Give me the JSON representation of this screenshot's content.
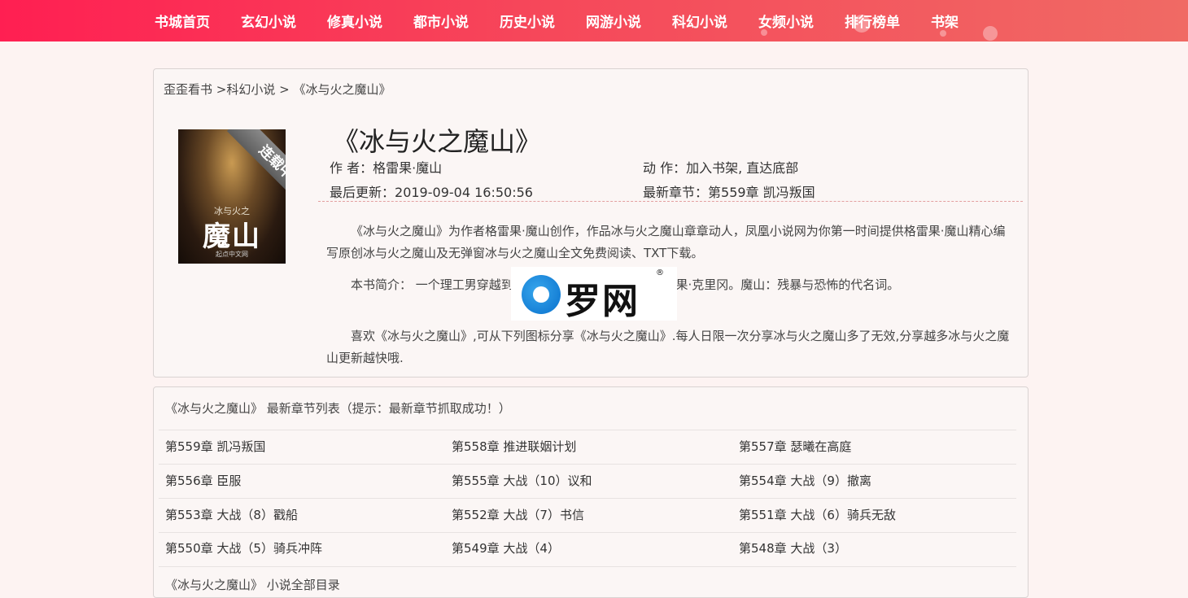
{
  "nav": [
    "书城首页",
    "玄幻小说",
    "修真小说",
    "都市小说",
    "历史小说",
    "网游小说",
    "科幻小说",
    "女频小说",
    "排行榜单",
    "书架"
  ],
  "breadcrumb": {
    "home": "歪歪看书",
    "sep1": " >",
    "category": "科幻小说",
    "sep2": " > ",
    "book": "《冰与火之魔山》"
  },
  "cover": {
    "ribbon": "连载中",
    "subtitle": "冰与火之",
    "title": "魔山",
    "publisher": "起点中文网"
  },
  "book": {
    "title": "《冰与火之魔山》",
    "author_label": "作  者：",
    "author": "格雷果·魔山",
    "action_label": "动  作：",
    "action_add": "加入书架",
    "action_sep": ", ",
    "action_bottom": "直达底部",
    "updated_label": "最后更新：",
    "updated": "2019-09-04 16:50:56",
    "latest_label": "最新章节：",
    "latest": "第559章 凯冯叛国"
  },
  "paragraphs": [
    "《冰与火之魔山》为作者格雷果·魔山创作，作品冰与火之魔山章章动人，凤凰小说网为你第一时间提供格雷果·魔山精心编写原创冰与火之魔山及无弹窗冰与火之魔山全文免费阅读、TXT下载。",
    "本书简介：  一个理工男穿越到                      最恶的凶人：人称魔山的格雷果·克里冈。魔山：残暴与恐怖的代名词。",
    "喜欢《冰与火之魔山》,可从下列图标分享《冰与火之魔山》.每人日限一次分享冰与火之魔山多了无效,分享越多冰与火之魔山更新越快哦."
  ],
  "watermark": {
    "text": "罗网",
    "reg": "®"
  },
  "chapter_list": {
    "heading": "《冰与火之魔山》 最新章节列表（提示：最新章节抓取成功！）",
    "items": [
      "第559章 凯冯叛国",
      "第558章 推进联姻计划",
      "第557章 瑟曦在高庭",
      "第556章 臣服",
      "第555章 大战（10）议和",
      "第554章 大战（9）撤离",
      "第553章 大战（8）戳船",
      "第552章 大战（7）书信",
      "第551章 大战（6）骑兵无敌",
      "第550章 大战（5）骑兵冲阵",
      "第549章 大战（4）",
      "第548章 大战（3）"
    ],
    "toc_heading": "《冰与火之魔山》 小说全部目录"
  },
  "colors": {
    "nav_gradient_start": "#ff1f52",
    "nav_gradient_end": "#f06a64",
    "page_bg": "#fdf3f2",
    "divider": "#e3a0a0"
  }
}
